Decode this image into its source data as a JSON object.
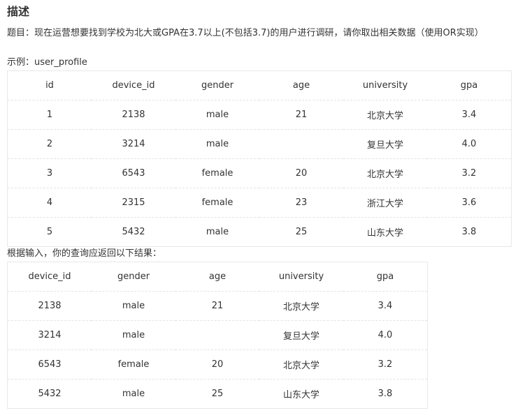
{
  "heading": "描述",
  "description": "题目：现在运营想要找到学校为北大或GPA在3.7以上(不包括3.7)的用户进行调研，请你取出相关数据（使用OR实现）",
  "example_label": "示例：user_profile",
  "example_table": {
    "columns": [
      "id",
      "device_id",
      "gender",
      "age",
      "university",
      "gpa"
    ],
    "rows": [
      [
        "1",
        "2138",
        "male",
        "21",
        "北京大学",
        "3.4"
      ],
      [
        "2",
        "3214",
        "male",
        "",
        "复旦大学",
        "4.0"
      ],
      [
        "3",
        "6543",
        "female",
        "20",
        "北京大学",
        "3.2"
      ],
      [
        "4",
        "2315",
        "female",
        "23",
        "浙江大学",
        "3.6"
      ],
      [
        "5",
        "5432",
        "male",
        "25",
        "山东大学",
        "3.8"
      ]
    ]
  },
  "result_label": "根据输入，你的查询应返回以下结果：",
  "result_table": {
    "columns": [
      "device_id",
      "gender",
      "age",
      "university",
      "gpa"
    ],
    "rows": [
      [
        "2138",
        "male",
        "21",
        "北京大学",
        "3.4"
      ],
      [
        "3214",
        "male",
        "",
        "复旦大学",
        "4.0"
      ],
      [
        "6543",
        "female",
        "20",
        "北京大学",
        "3.2"
      ],
      [
        "5432",
        "male",
        "25",
        "山东大学",
        "3.8"
      ]
    ]
  }
}
